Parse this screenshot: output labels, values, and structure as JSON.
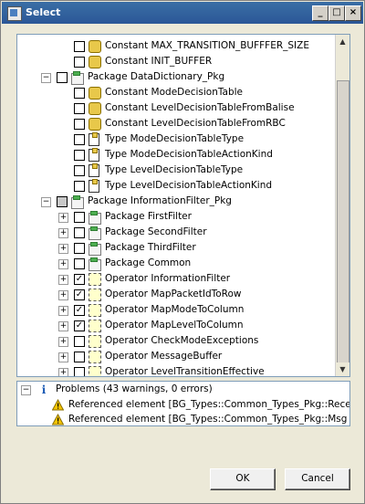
{
  "window": {
    "title": "Select"
  },
  "titlebar_buttons": {
    "minimize": "_",
    "maximize": "□",
    "close": "×"
  },
  "tree": {
    "rows": [
      {
        "label": "Constant MAX_TRANSITION_BUFFFER_SIZE",
        "icon": "constant-icon",
        "checked": false
      },
      {
        "label": "Constant INIT_BUFFER",
        "icon": "constant-icon",
        "checked": false
      },
      {
        "label": "Package DataDictionary_Pkg",
        "icon": "package-icon",
        "checked": false,
        "expander": "−"
      },
      {
        "label": "Constant ModeDecisionTable",
        "icon": "constant-icon",
        "checked": false
      },
      {
        "label": "Constant LevelDecisionTableFromBalise",
        "icon": "constant-icon",
        "checked": false
      },
      {
        "label": "Constant LevelDecisionTableFromRBC",
        "icon": "constant-icon",
        "checked": false
      },
      {
        "label": "Type ModeDecisionTableType",
        "icon": "type-icon",
        "checked": false
      },
      {
        "label": "Type ModeDecisionTableActionKind",
        "icon": "type-icon",
        "checked": false
      },
      {
        "label": "Type LevelDecisionTableType",
        "icon": "type-icon",
        "checked": false
      },
      {
        "label": "Type LevelDecisionTableActionKind",
        "icon": "type-icon",
        "checked": false
      },
      {
        "label": "Package InformationFilter_Pkg",
        "icon": "package-icon",
        "checked": "partial",
        "expander": "−"
      },
      {
        "label": "Package FirstFilter",
        "icon": "package-icon",
        "checked": false,
        "expander": "+"
      },
      {
        "label": "Package SecondFilter",
        "icon": "package-icon",
        "checked": false,
        "expander": "+"
      },
      {
        "label": "Package ThirdFilter",
        "icon": "package-icon",
        "checked": false,
        "expander": "+"
      },
      {
        "label": "Package Common",
        "icon": "package-icon",
        "checked": false,
        "expander": "+"
      },
      {
        "label": "Operator InformationFilter",
        "icon": "operator-icon",
        "checked": true,
        "expander": "+"
      },
      {
        "label": "Operator MapPacketIdToRow",
        "icon": "operator-icon",
        "checked": true,
        "expander": "+"
      },
      {
        "label": "Operator MapModeToColumn",
        "icon": "operator-icon",
        "checked": true,
        "expander": "+"
      },
      {
        "label": "Operator MapLevelToColumn",
        "icon": "operator-icon",
        "checked": true,
        "expander": "+"
      },
      {
        "label": "Operator CheckModeExceptions",
        "icon": "operator-icon",
        "checked": false,
        "expander": "+"
      },
      {
        "label": "Operator MessageBuffer",
        "icon": "operator-icon",
        "checked": false,
        "expander": "+"
      },
      {
        "label": "Operator LevelTransitionEffective",
        "icon": "operator-icon",
        "checked": false,
        "expander": "+"
      }
    ]
  },
  "problems": {
    "header": "Problems (43 warnings, 0 errors)",
    "items": [
      {
        "text": "Referenced element [BG_Types::Common_Types_Pkg::Rece"
      },
      {
        "text": "Referenced element [BG_Types::Common_Types_Pkg::Msg"
      }
    ]
  },
  "buttons": {
    "ok": "OK",
    "cancel": "Cancel"
  }
}
